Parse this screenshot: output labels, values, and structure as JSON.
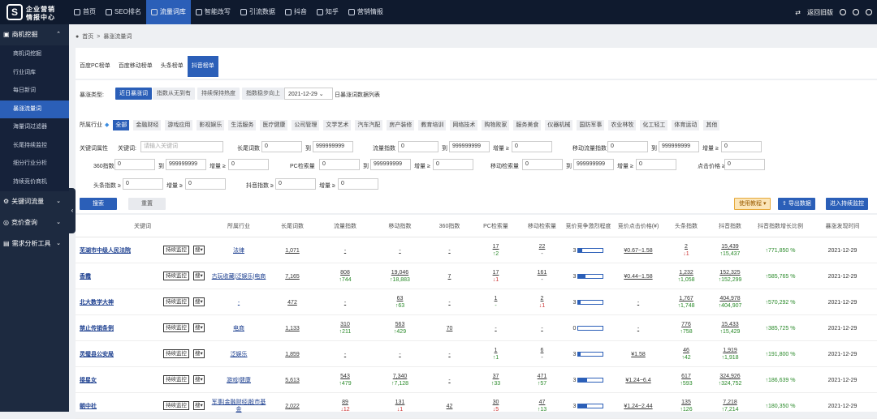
{
  "logo": {
    "line1": "企业营销",
    "line2": "情报中心",
    "mark": "S"
  },
  "nav": [
    {
      "label": "首页",
      "icon": "home-icon"
    },
    {
      "label": "SEO排名",
      "icon": "chart-icon"
    },
    {
      "label": "流量词库",
      "icon": "sparkle-icon",
      "active": true
    },
    {
      "label": "智能改写",
      "icon": "edit-icon"
    },
    {
      "label": "引流数据",
      "icon": "data-icon"
    },
    {
      "label": "抖音",
      "icon": "douyin-icon"
    },
    {
      "label": "知乎",
      "icon": "zhihu-icon"
    },
    {
      "label": "营销情报",
      "icon": "radar-icon"
    }
  ],
  "top_right": {
    "back": "返回旧版"
  },
  "sidebar": {
    "section1": "商机挖掘",
    "items": [
      "商机词挖掘",
      "行业词库",
      "每日新词",
      "暴涨流量词",
      "海量词过滤器",
      "长尾持续监控",
      "细分行业分析",
      "持续竞价商机"
    ],
    "active_index": 3,
    "section2": "关键词流量",
    "section3": "竞价查询",
    "section4": "需求分析工具"
  },
  "breadcrumb": {
    "home": "首页",
    "sep": ">",
    "current": "暴涨流量词"
  },
  "tabs": [
    "百度PC榜单",
    "百度移动榜单",
    "头条榜单",
    "抖音榜单"
  ],
  "tabs_active": 3,
  "surge": {
    "label": "暴涨类型:",
    "buttons": [
      "近日暴涨词",
      "指数从无到有",
      "持续保持热度",
      "指数稳步向上"
    ],
    "active": 0,
    "date": "2021-12-29",
    "date_suffix": "日暴涨词数据列表"
  },
  "industry": {
    "label": "所属行业",
    "chips": [
      "全部",
      "金融财经",
      "游戏应用",
      "影视娱乐",
      "生活服务",
      "医疗健康",
      "公司管理",
      "文学艺术",
      "汽车汽配",
      "房产装修",
      "教育培训",
      "网络技术",
      "购物败家",
      "服务美食",
      "仪器机械",
      "国防军事",
      "农业林牧",
      "化工轻工",
      "体育运动",
      "其他"
    ],
    "active": 0
  },
  "filters": {
    "attr_label": "关键词属性",
    "kw_label": "关键词:",
    "kw_placeholder": "请输入关键词",
    "to": "到",
    "zero": "0",
    "nine": "999999999",
    "ge": "增量 ≥",
    "longtail": "长尾词数",
    "flow": "流量指数",
    "mobile_flow": "移动流量指数",
    "idx360": "360指数",
    "pc_search": "PC检索量",
    "mobile_search": "移动检索量",
    "click_price": "点击价格 ≥",
    "toutiao": "头条指数 ≥",
    "douyin": "抖音指数 ≥"
  },
  "actions": {
    "search": "搜索",
    "reset": "重置",
    "guide": "使用教程",
    "export": "导出数据",
    "monitor": "进入持续监控"
  },
  "table": {
    "headers": [
      "关键词",
      "所属行业",
      "长尾词数",
      "流量指数",
      "移动指数",
      "360指数",
      "PC检索量",
      "移动检索量",
      "竞价竞争激烈程度",
      "竞价点击价格(¥)",
      "头条指数",
      "抖音指数",
      "抖音指数增长比例",
      "暴涨发现时间"
    ],
    "monitor_label": "持续监控",
    "select_label": "搜",
    "rows": [
      {
        "kw": "芜湖市中级人民法院",
        "ind": "法律",
        "lt": "1,071",
        "flow": "-",
        "flow_d": "",
        "mob": "-",
        "mob_d": "",
        "i360": "-",
        "pc": "17",
        "pc_d": "↑2",
        "pc_up": true,
        "mobs": "22",
        "mobs_d": "-",
        "bid": "3",
        "bid_f": 0.15,
        "price": "¥0.67~1.58",
        "tt": "2",
        "tt_d": "↓1",
        "tt_up": false,
        "dy": "15,439",
        "dy_d": "↑15,437",
        "dy_up": true,
        "gr": "↑771,850 %",
        "date": "2021-12-29"
      },
      {
        "kw": "香霞",
        "ind": "古玩收藏|泛娱乐|电商",
        "lt": "7,165",
        "flow": "808",
        "flow_d": "↑744",
        "mob": "19,046",
        "mob_d": "↑18,883",
        "i360": "7",
        "pc": "17",
        "pc_d": "↓1",
        "pc_up": false,
        "mobs": "161",
        "mobs_d": "-",
        "bid": "3",
        "bid_f": 0.3,
        "price": "¥0.44~1.58",
        "tt": "1,232",
        "tt_d": "↑1,058",
        "tt_up": true,
        "dy": "152,325",
        "dy_d": "↑152,299",
        "dy_up": true,
        "gr": "↑585,765 %",
        "date": "2021-12-29"
      },
      {
        "kw": "北大数学大神",
        "ind": "-",
        "lt": "472",
        "flow": "-",
        "flow_d": "",
        "mob": "63",
        "mob_d": "↑63",
        "i360": "-",
        "pc": "1",
        "pc_d": "-",
        "pc_up": true,
        "mobs": "2",
        "mobs_d": "↓1",
        "bid": "3",
        "bid_f": 0.1,
        "price": "-",
        "tt": "1,767",
        "tt_d": "↑1,748",
        "tt_up": true,
        "dy": "404,978",
        "dy_d": "↑404,907",
        "dy_up": true,
        "gr": "↑570,292 %",
        "date": "2021-12-29"
      },
      {
        "kw": "禁止传销条例",
        "ind": "电商",
        "lt": "1,133",
        "flow": "310",
        "flow_d": "↑211",
        "mob": "563",
        "mob_d": "↑429",
        "i360": "70",
        "pc": "-",
        "pc_d": "",
        "pc_up": true,
        "mobs": "-",
        "mobs_d": "",
        "bid": "0",
        "bid_f": 0,
        "price": "-",
        "tt": "776",
        "tt_d": "↑758",
        "tt_up": true,
        "dy": "15,433",
        "dy_d": "↑15,429",
        "dy_up": true,
        "gr": "↑385,725 %",
        "date": "2021-12-29"
      },
      {
        "kw": "灵璧县公安局",
        "ind": "泛娱乐",
        "lt": "1,859",
        "flow": "-",
        "flow_d": "",
        "mob": "-",
        "mob_d": "",
        "i360": "-",
        "pc": "1",
        "pc_d": "↑1",
        "pc_up": true,
        "mobs": "6",
        "mobs_d": "-",
        "bid": "3",
        "bid_f": 0.1,
        "price": "¥1.58",
        "tt": "46",
        "tt_d": "↑42",
        "tt_up": true,
        "dy": "1,919",
        "dy_d": "↑1,918",
        "dy_up": true,
        "gr": "↑191,800 %",
        "date": "2021-12-29"
      },
      {
        "kw": "接星女",
        "ind": "游戏|健康",
        "lt": "5,613",
        "flow": "543",
        "flow_d": "↑479",
        "mob": "7,340",
        "mob_d": "↑7,128",
        "i360": "-",
        "pc": "37",
        "pc_d": "↑33",
        "pc_up": true,
        "mobs": "471",
        "mobs_d": "↑57",
        "bid": "3",
        "bid_f": 0.35,
        "price": "¥1.24~6.4",
        "tt": "617",
        "tt_d": "↑593",
        "tt_up": true,
        "dy": "324,926",
        "dy_d": "↑324,752",
        "dy_up": true,
        "gr": "↑186,639 %",
        "date": "2021-12-29"
      },
      {
        "kw": "朝中社",
        "ind": "军事|金融财经|股市基金",
        "lt": "2,022",
        "flow": "89",
        "flow_d": "↓12",
        "mob": "131",
        "mob_d": "↓1",
        "i360": "42",
        "pc": "30",
        "pc_d": "↓5",
        "pc_up": false,
        "mobs": "47",
        "mobs_d": "↑13",
        "bid": "3",
        "bid_f": 0.35,
        "price": "¥1.24~2.44",
        "tt": "135",
        "tt_d": "↑126",
        "tt_up": true,
        "dy": "7,218",
        "dy_d": "↑7,214",
        "dy_up": true,
        "gr": "↑180,350 %",
        "date": "2021-12-29"
      }
    ]
  }
}
